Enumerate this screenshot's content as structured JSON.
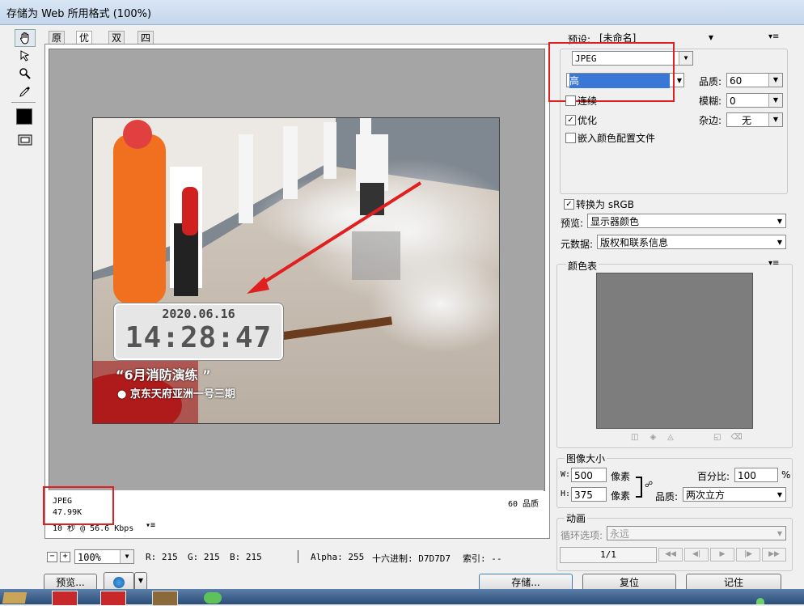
{
  "window": {
    "title": "存储为 Web 所用格式 (100%)"
  },
  "tabs": [
    {
      "label": "原稿"
    },
    {
      "label": "优化"
    },
    {
      "label": "双联"
    },
    {
      "label": "四联"
    }
  ],
  "photo": {
    "date": "2020.06.16",
    "time": "14:28:47",
    "caption_title": "“6月消防演练 ”",
    "caption_location": "京东天府亚洲一号三期"
  },
  "info": {
    "format": "JPEG",
    "size": "47.99K",
    "speed": "10 秒 @ 56.6 Kbps",
    "quality": "60 品质"
  },
  "status": {
    "zoom": "100%",
    "r": "R: 215",
    "g": "G: 215",
    "b": "B: 215",
    "alpha": "Alpha: 255",
    "hex": "十六进制: D7D7D7",
    "index": "索引: --"
  },
  "bottom_buttons": {
    "preview": "预览...",
    "save": "存储...",
    "reset": "复位",
    "remember": "记住"
  },
  "settings": {
    "preset_label": "预设:",
    "preset_value": "[未命名]",
    "format": "JPEG",
    "quality_level": "高",
    "quality_label": "品质:",
    "quality_value": "60",
    "progressive_label": "连续",
    "blur_label": "模糊:",
    "blur_value": "0",
    "optimized_label": "优化",
    "matte_label": "杂边:",
    "matte_value": "无",
    "embed_profile_label": "嵌入颜色配置文件",
    "convert_srgb_label": "转换为 sRGB",
    "preview_label": "预览:",
    "preview_value": "显示器颜色",
    "metadata_label": "元数据:",
    "metadata_value": "版权和联系信息",
    "color_table_label": "颜色表"
  },
  "image_size": {
    "title": "图像大小",
    "w_label": "W:",
    "w_value": "500",
    "h_label": "H:",
    "h_value": "375",
    "unit": "像素",
    "percent_label": "百分比:",
    "percent_value": "100",
    "percent_unit": "%",
    "quality_label": "品质:",
    "quality_value": "两次立方"
  },
  "animation": {
    "title": "动画",
    "loop_label": "循环选项:",
    "loop_value": "永远",
    "frame": "1/1"
  },
  "colors": {
    "accent_red": "#e02020",
    "canvas_gray": "#a5a5a5",
    "color_table_gray": "#7d7d7d",
    "selection_blue": "#3a78d8"
  }
}
